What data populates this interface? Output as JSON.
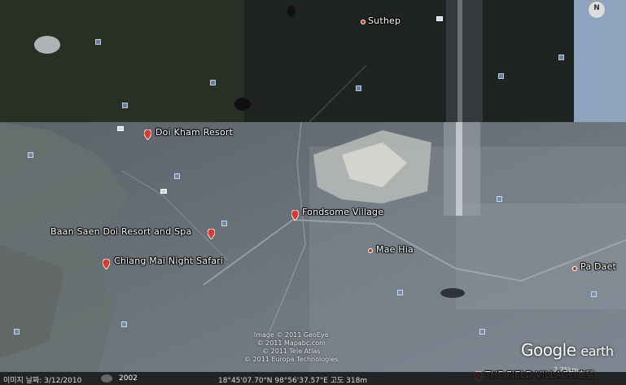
{
  "places": {
    "suthep": "Suthep",
    "doi_kham": "Doi Kham Resort",
    "fondsome": "Fondsome Village",
    "baan_saen_doi": "Baan Saen Doi Resort and Spa",
    "night_safari": "Chiang Mai Night Safari",
    "mae_hia": "Mae Hia",
    "pa_daet": "Pa Daet",
    "field_village": "THE FIELD VILLAGE 호텔"
  },
  "attribution": {
    "line1": "Image © 2011 GeoEye",
    "line2": "© 2011 Mapabc.com",
    "line3": "© 2011 Tele Atlas",
    "line4": "© 2011 Europa Technologies"
  },
  "logo": {
    "google": "Google",
    "earth": "earth"
  },
  "statusbar": {
    "imagery_date": "이미지 날짜: 3/12/2010",
    "year": "2002",
    "coordinates": "18°45'07.70\"N  98°56'37.57\"E  고도  318m"
  },
  "scale": "7.75km",
  "compass": "N",
  "colors": {
    "pin": "#d93a2f",
    "label": "#ffffff",
    "statusbar": "#141414"
  }
}
